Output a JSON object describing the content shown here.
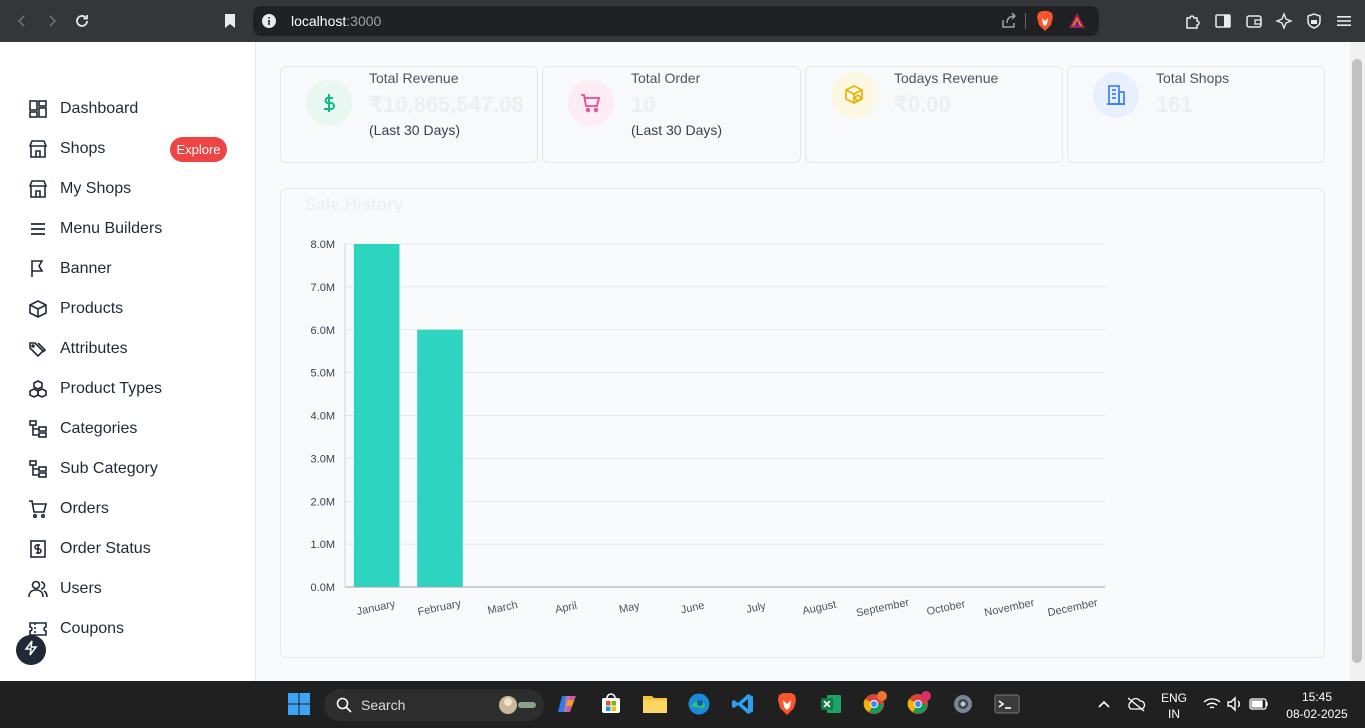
{
  "browser": {
    "url_host": "localhost",
    "url_port": ":3000"
  },
  "sidebar": {
    "items": [
      {
        "label": "Dashboard",
        "icon": "dashboard-icon"
      },
      {
        "label": "Shops",
        "icon": "store-icon"
      },
      {
        "label": "My Shops",
        "icon": "store-icon"
      },
      {
        "label": "Menu Builders",
        "icon": "menu-icon"
      },
      {
        "label": "Banner",
        "icon": "flag-icon"
      },
      {
        "label": "Products",
        "icon": "box-icon"
      },
      {
        "label": "Attributes",
        "icon": "tags-icon"
      },
      {
        "label": "Product Types",
        "icon": "cubes-icon"
      },
      {
        "label": "Categories",
        "icon": "tree-icon"
      },
      {
        "label": "Sub Category",
        "icon": "tree-icon"
      },
      {
        "label": "Orders",
        "icon": "cart-icon"
      },
      {
        "label": "Order Status",
        "icon": "receipt-icon"
      },
      {
        "label": "Users",
        "icon": "users-icon"
      },
      {
        "label": "Coupons",
        "icon": "ticket-icon"
      }
    ],
    "explore_badge": "Explore"
  },
  "stats": [
    {
      "title": "Total Revenue",
      "value": "₹10,865,547.08",
      "sub": "(Last 30 Days)",
      "icon": "dollar-icon",
      "color": "#10b981",
      "bg": "#e8f8f1"
    },
    {
      "title": "Total Order",
      "value": "10",
      "sub": "(Last 30 Days)",
      "icon": "cart-icon",
      "color": "#ec4899",
      "bg": "#fdecf3"
    },
    {
      "title": "Todays Revenue",
      "value": "₹0.00",
      "sub": "",
      "icon": "package-icon",
      "color": "#eab308",
      "bg": "#fdf8e2"
    },
    {
      "title": "Total Shops",
      "value": "161",
      "sub": "",
      "icon": "building-icon",
      "color": "#3b82f6",
      "bg": "#e9f0fd"
    }
  ],
  "chart_title": "Sale History",
  "chart_data": {
    "type": "bar",
    "title": "Sale History",
    "categories": [
      "January",
      "February",
      "March",
      "April",
      "May",
      "June",
      "July",
      "August",
      "September",
      "October",
      "November",
      "December"
    ],
    "values": [
      8000000,
      6000000,
      0,
      0,
      0,
      0,
      0,
      0,
      0,
      0,
      0,
      0
    ],
    "ytick_labels": [
      "0.0M",
      "1.0M",
      "2.0M",
      "3.0M",
      "4.0M",
      "5.0M",
      "6.0M",
      "7.0M",
      "8.0M"
    ],
    "ylim": [
      0,
      8000000
    ],
    "bar_color": "#2dd4bf",
    "grid": true
  },
  "taskbar": {
    "search_label": "Search",
    "lang_top": "ENG",
    "lang_bottom": "IN",
    "time": "15:45",
    "date": "08-02-2025"
  }
}
